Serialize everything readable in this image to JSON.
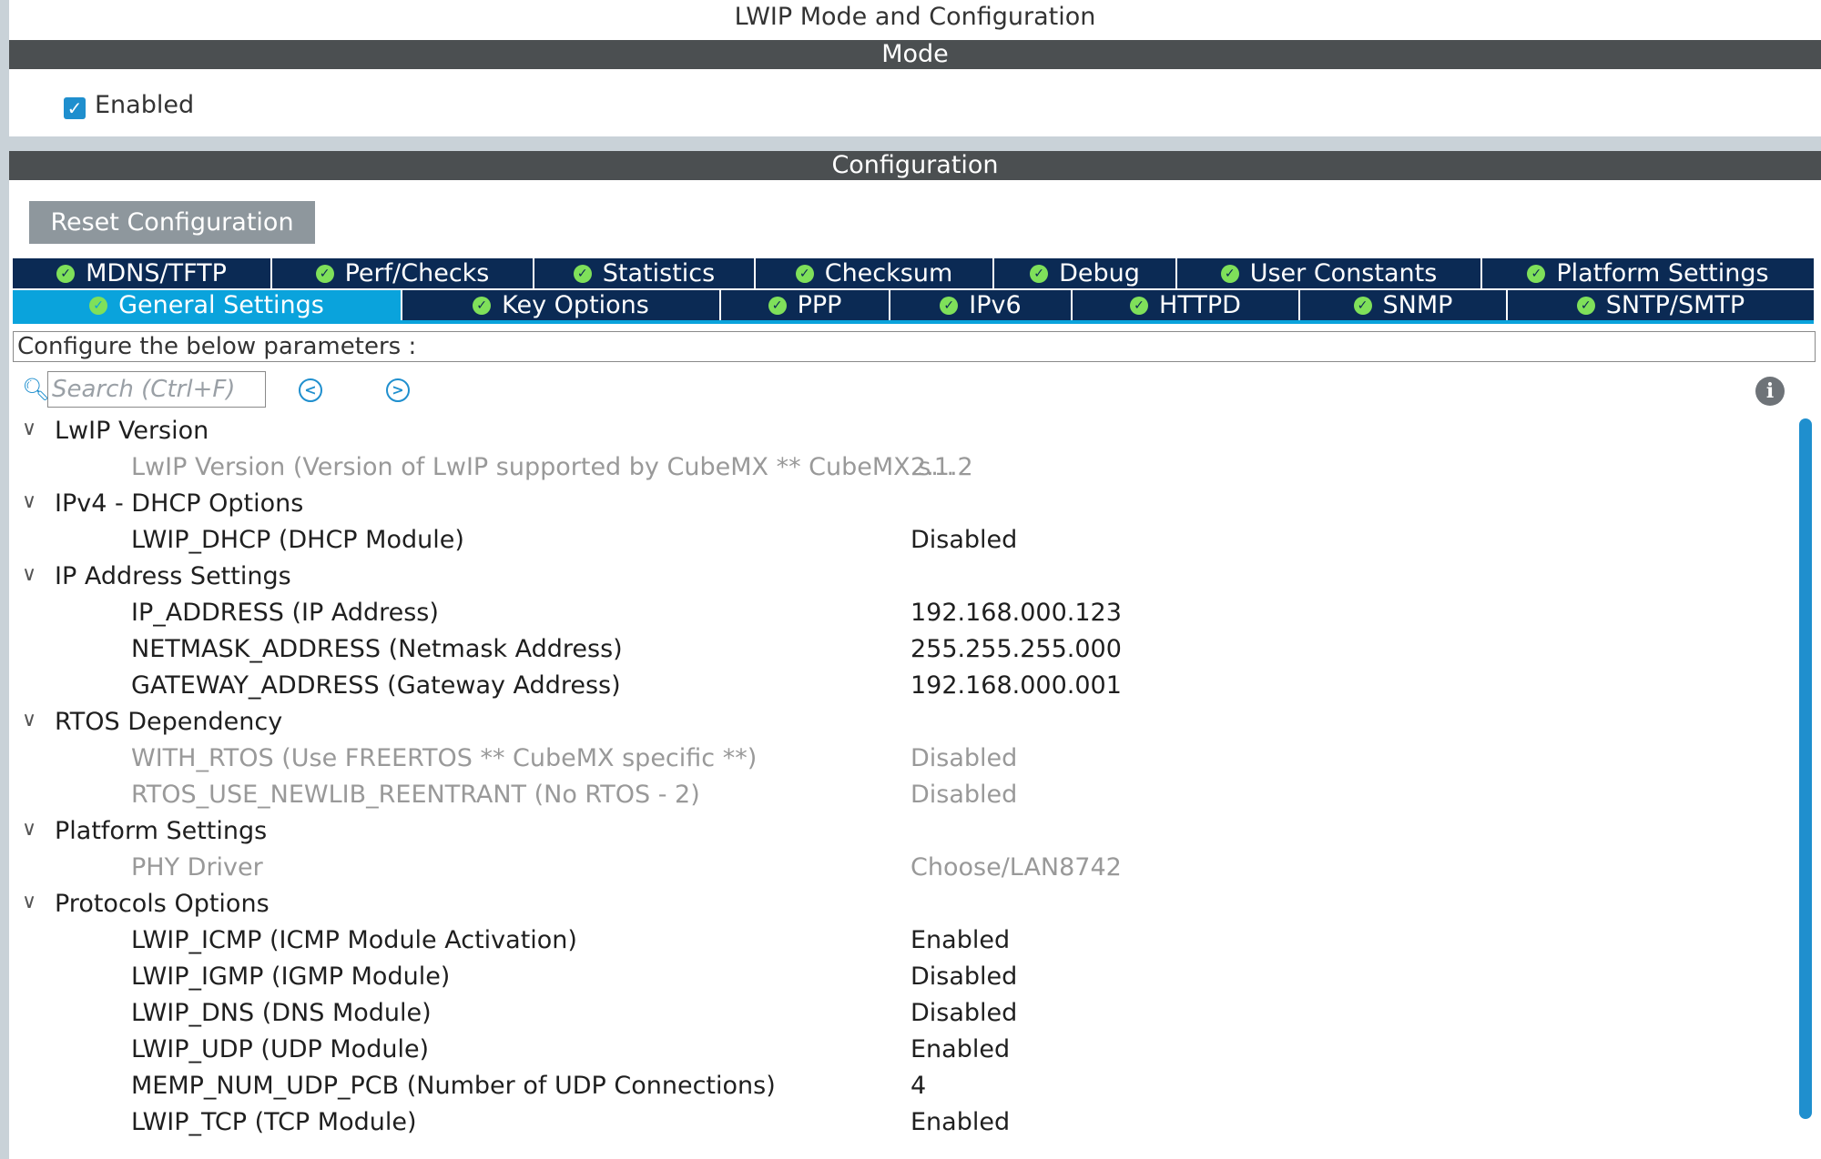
{
  "window": {
    "title": "LWIP Mode and Configuration"
  },
  "mode": {
    "header": "Mode",
    "enabled_label": "Enabled",
    "enabled_checked": true
  },
  "configuration": {
    "header": "Configuration",
    "reset_label": "Reset Configuration",
    "tabs_row1": [
      {
        "label": "MDNS/TFTP"
      },
      {
        "label": "Perf/Checks"
      },
      {
        "label": "Statistics"
      },
      {
        "label": "Checksum"
      },
      {
        "label": "Debug"
      },
      {
        "label": "User Constants"
      },
      {
        "label": "Platform Settings"
      }
    ],
    "tabs_row2": [
      {
        "label": "General Settings",
        "active": true
      },
      {
        "label": "Key Options"
      },
      {
        "label": "PPP"
      },
      {
        "label": "IPv6"
      },
      {
        "label": "HTTPD"
      },
      {
        "label": "SNMP"
      },
      {
        "label": "SNTP/SMTP"
      }
    ],
    "configure_text": "Configure the below parameters :",
    "search_placeholder": "Search (Ctrl+F)",
    "colors": {
      "active_tab": "#0aa3dc",
      "tab_bg": "#0b2a54",
      "check_icon": "#7fe05a",
      "accent": "#1f8fce"
    }
  },
  "tree": [
    {
      "group": "LwIP Version",
      "items": [
        {
          "name": "LwIP Version (Version of LwIP supported by CubeMX ** CubeMX s...",
          "value": "2.1.2",
          "disabled": true
        }
      ]
    },
    {
      "group": "IPv4 - DHCP Options",
      "items": [
        {
          "name": "LWIP_DHCP (DHCP Module)",
          "value": "Disabled",
          "disabled": false
        }
      ]
    },
    {
      "group": "IP Address Settings",
      "items": [
        {
          "name": "IP_ADDRESS (IP Address)",
          "value": "192.168.000.123",
          "disabled": false
        },
        {
          "name": "NETMASK_ADDRESS (Netmask Address)",
          "value": "255.255.255.000",
          "disabled": false
        },
        {
          "name": "GATEWAY_ADDRESS (Gateway Address)",
          "value": "192.168.000.001",
          "disabled": false
        }
      ]
    },
    {
      "group": "RTOS Dependency",
      "items": [
        {
          "name": "WITH_RTOS (Use FREERTOS ** CubeMX specific **)",
          "value": "Disabled",
          "disabled": true
        },
        {
          "name": "RTOS_USE_NEWLIB_REENTRANT (No RTOS - 2)",
          "value": "Disabled",
          "disabled": true
        }
      ]
    },
    {
      "group": "Platform Settings",
      "items": [
        {
          "name": "PHY Driver",
          "value": "Choose/LAN8742",
          "disabled": true
        }
      ]
    },
    {
      "group": "Protocols Options",
      "items": [
        {
          "name": "LWIP_ICMP (ICMP Module Activation)",
          "value": "Enabled",
          "disabled": false
        },
        {
          "name": "LWIP_IGMP (IGMP Module)",
          "value": "Disabled",
          "disabled": false
        },
        {
          "name": "LWIP_DNS (DNS Module)",
          "value": "Disabled",
          "disabled": false
        },
        {
          "name": "LWIP_UDP (UDP Module)",
          "value": "Enabled",
          "disabled": false
        },
        {
          "name": "MEMP_NUM_UDP_PCB (Number of UDP Connections)",
          "value": "4",
          "disabled": false
        },
        {
          "name": "LWIP_TCP (TCP Module)",
          "value": "Enabled",
          "disabled": false
        }
      ]
    }
  ]
}
